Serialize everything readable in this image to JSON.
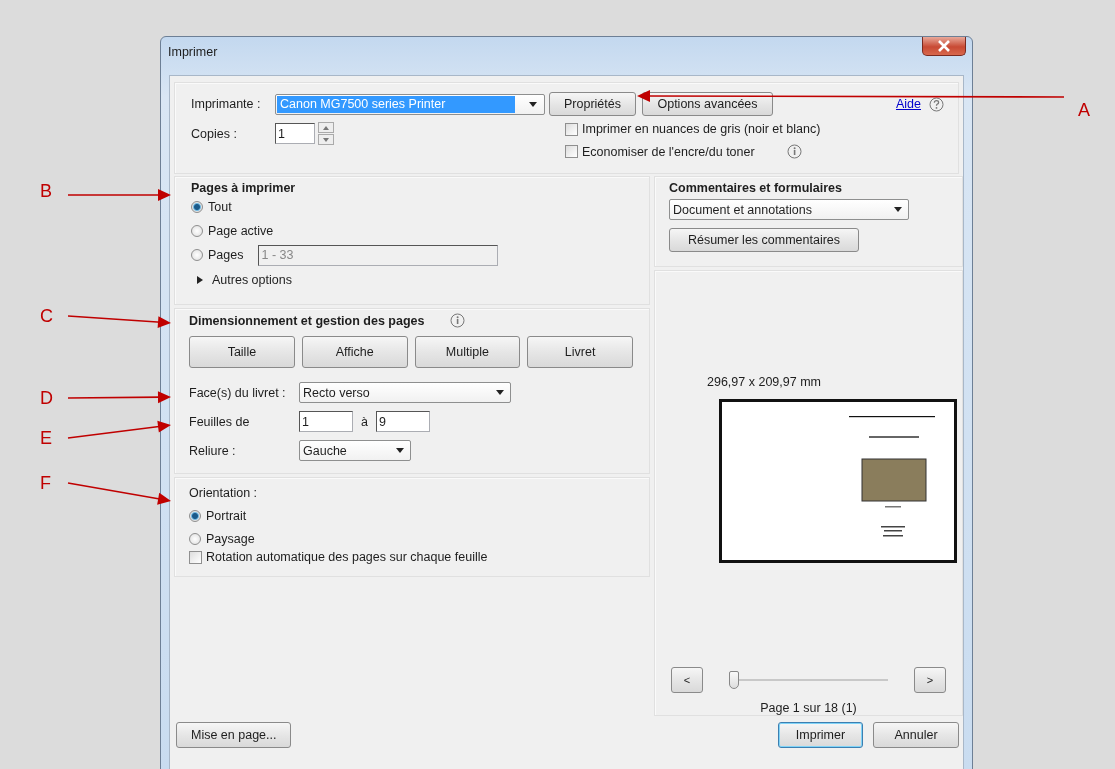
{
  "window": {
    "title": "Imprimer"
  },
  "printer": {
    "label": "Imprimante :",
    "value": "Canon MG7500 series Printer",
    "buttons": [
      "Propriétés",
      "Options avancées"
    ]
  },
  "help": {
    "label": "Aide"
  },
  "copies": {
    "label": "Copies :",
    "value": "1"
  },
  "print_options": [
    {
      "label": "Imprimer en nuances de gris (noir et blanc)",
      "checked": false,
      "info": false
    },
    {
      "label": "Economiser de l'encre/du toner",
      "checked": false,
      "info": true
    }
  ],
  "pages_to_print": {
    "title": "Pages à imprimer",
    "options": [
      {
        "label": "Tout",
        "selected": true
      },
      {
        "label": "Page active",
        "selected": false
      },
      {
        "label": "Pages",
        "selected": false,
        "range": "1 - 33"
      }
    ],
    "more": {
      "label": "Autres options",
      "expanded": false
    }
  },
  "sizing": {
    "title": "Dimensionnement et gestion des pages",
    "modes": [
      "Taille",
      "Affiche",
      "Multiple",
      "Livret"
    ],
    "booklet_sides": {
      "label": "Face(s) du livret :",
      "value": "Recto verso"
    },
    "sheets": {
      "label": "Feuilles de",
      "from": "1",
      "to_label": "à",
      "to": "9"
    },
    "binding": {
      "label": "Reliure :",
      "value": "Gauche"
    }
  },
  "orientation": {
    "title": "Orientation :",
    "options": [
      {
        "label": "Portrait",
        "selected": true
      },
      {
        "label": "Paysage",
        "selected": false
      }
    ],
    "auto_rotate": {
      "label": "Rotation automatique des pages sur chaque feuille",
      "checked": false
    }
  },
  "comments": {
    "title": "Commentaires et formulaires",
    "value": "Document et annotations",
    "button": "Résumer les commentaires"
  },
  "preview": {
    "size": "296,97 x 209,97 mm",
    "prev": "<",
    "next": ">",
    "slider": {
      "level": 0.02
    },
    "page_info": "Page 1 sur 18 (1)"
  },
  "footer": {
    "setup_button": "Mise en page...",
    "print_button": "Imprimer",
    "cancel_button": "Annuler"
  },
  "annotations": [
    {
      "label": "A"
    },
    {
      "label": "B"
    },
    {
      "label": "C"
    },
    {
      "label": "D"
    },
    {
      "label": "E"
    },
    {
      "label": "F"
    }
  ]
}
